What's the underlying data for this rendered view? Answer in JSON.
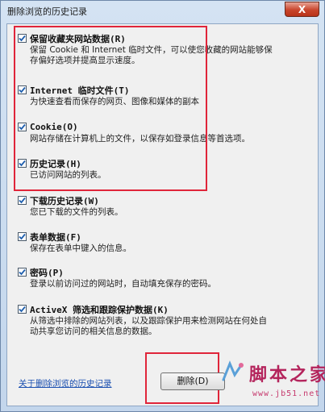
{
  "window": {
    "title": "删除浏览的历史记录",
    "close_label": "X"
  },
  "options": [
    {
      "label": "保留收藏夹网站数据(R)",
      "checked": true,
      "lines": [
        "保留 Cookie 和 Internet 临时文件，可以使您收藏的网站能够保",
        "存偏好选项并提高显示速度。"
      ]
    },
    {
      "label": "Internet 临时文件(T)",
      "checked": true,
      "lines": [
        "为快速查看而保存的网页、图像和媒体的副本"
      ]
    },
    {
      "label": "Cookie(O)",
      "checked": true,
      "lines": [
        "网站存储在计算机上的文件，以保存如登录信息等首选项。"
      ]
    },
    {
      "label": "历史记录(H)",
      "checked": true,
      "lines": [
        "已访问网站的列表。"
      ]
    },
    {
      "label": "下载历史记录(W)",
      "checked": true,
      "lines": [
        "您已下载的文件的列表。"
      ]
    },
    {
      "label": "表单数据(F)",
      "checked": true,
      "lines": [
        "保存在表单中键入的信息。"
      ]
    },
    {
      "label": "密码(P)",
      "checked": true,
      "lines": [
        "登录以前访问过的网站时，自动填充保存的密码。"
      ]
    },
    {
      "label": "ActiveX 筛选和跟踪保护数据(K)",
      "checked": true,
      "lines": [
        "从筛选中排除的网站列表，以及跟踪保护用来检测网站在何处自",
        "动共享您访问的相关信息的数据。"
      ]
    }
  ],
  "footer": {
    "link_label": "关于删除浏览的历史记录",
    "delete_label": "删除(D)"
  },
  "watermark": {
    "text": "脚本之家",
    "url": "www.jb51.net"
  },
  "colors": {
    "highlight": "#e0253a",
    "link": "#1a4fb0",
    "check": "#1f5fae"
  }
}
